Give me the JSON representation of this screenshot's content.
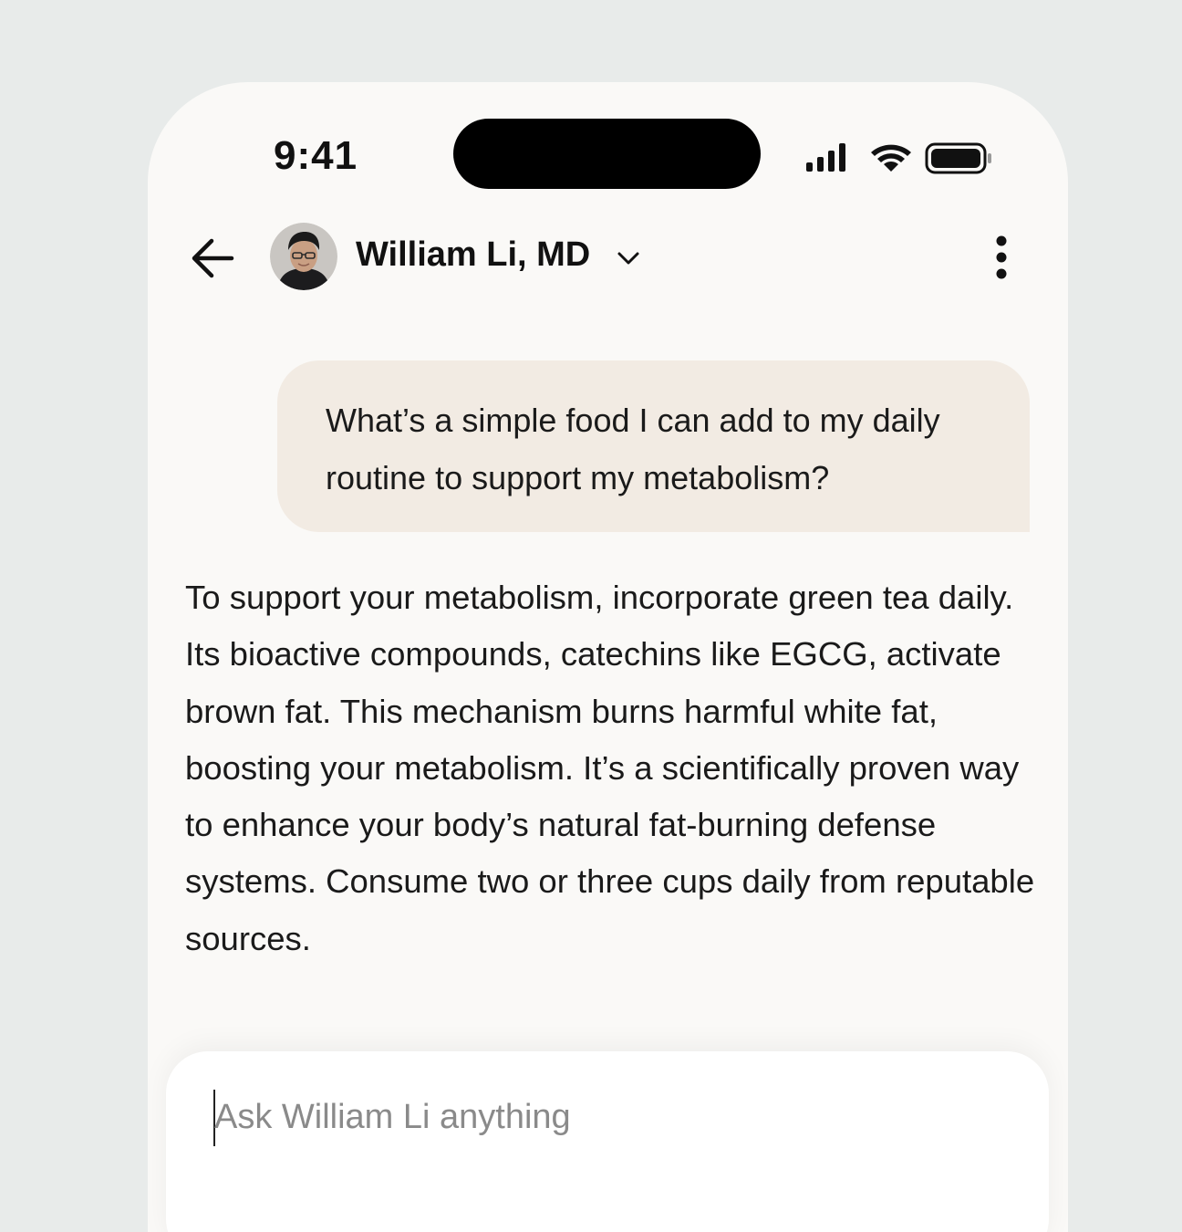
{
  "status_bar": {
    "time": "9:41"
  },
  "header": {
    "back_icon": "arrow-left-icon",
    "contact_name": "William Li, MD",
    "dropdown_icon": "chevron-down-icon",
    "menu_icon": "more-vertical-icon"
  },
  "messages": {
    "user_message": "What’s a simple food I can add to my daily routine to support my metabolism?",
    "assistant_reply": "To support your metabolism, incorporate green tea daily. Its bioactive compounds, catechins like EGCG, activate brown fat. This mechanism burns harmful white fat, boosting your metabolism. It’s a scientifically proven way to enhance your body’s natural fat-burning defense systems. Consume two or three cups daily from reputable sources."
  },
  "composer": {
    "placeholder": "Ask William Li anything",
    "value": ""
  },
  "colors": {
    "background": "#e8ebea",
    "phone_surface": "#faf9f7",
    "user_bubble": "#f2ebe3",
    "text": "#1a1a1a"
  }
}
